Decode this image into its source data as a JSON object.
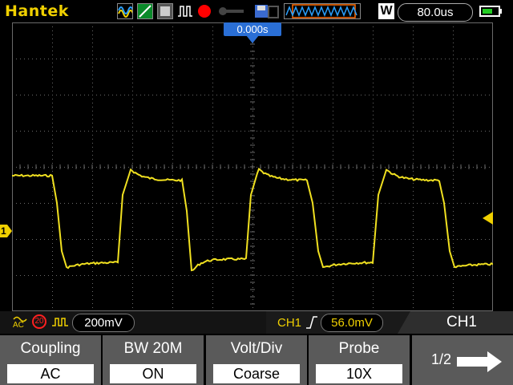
{
  "topbar": {
    "brand": "Hantek",
    "timebase": "80.0us",
    "memory_depth_label": "W"
  },
  "screen": {
    "trigger_time": "0.000s",
    "channel_marker": "1"
  },
  "status": {
    "coupling_badge": "AC",
    "bw_badge": "20",
    "volt_div": "200mV",
    "trigger_source": "CH1",
    "trigger_level": "56.0mV",
    "active_tab": "CH1"
  },
  "menu": {
    "items": [
      {
        "label": "Coupling",
        "value": "AC"
      },
      {
        "label": "BW 20M",
        "value": "ON"
      },
      {
        "label": "Volt/Div",
        "value": "Coarse"
      },
      {
        "label": "Probe",
        "value": "10X"
      }
    ],
    "page": "1/2"
  },
  "colors": {
    "trace": "#f0e020",
    "grid": "#6a6a6a",
    "accent": "#2a6fd6"
  }
}
